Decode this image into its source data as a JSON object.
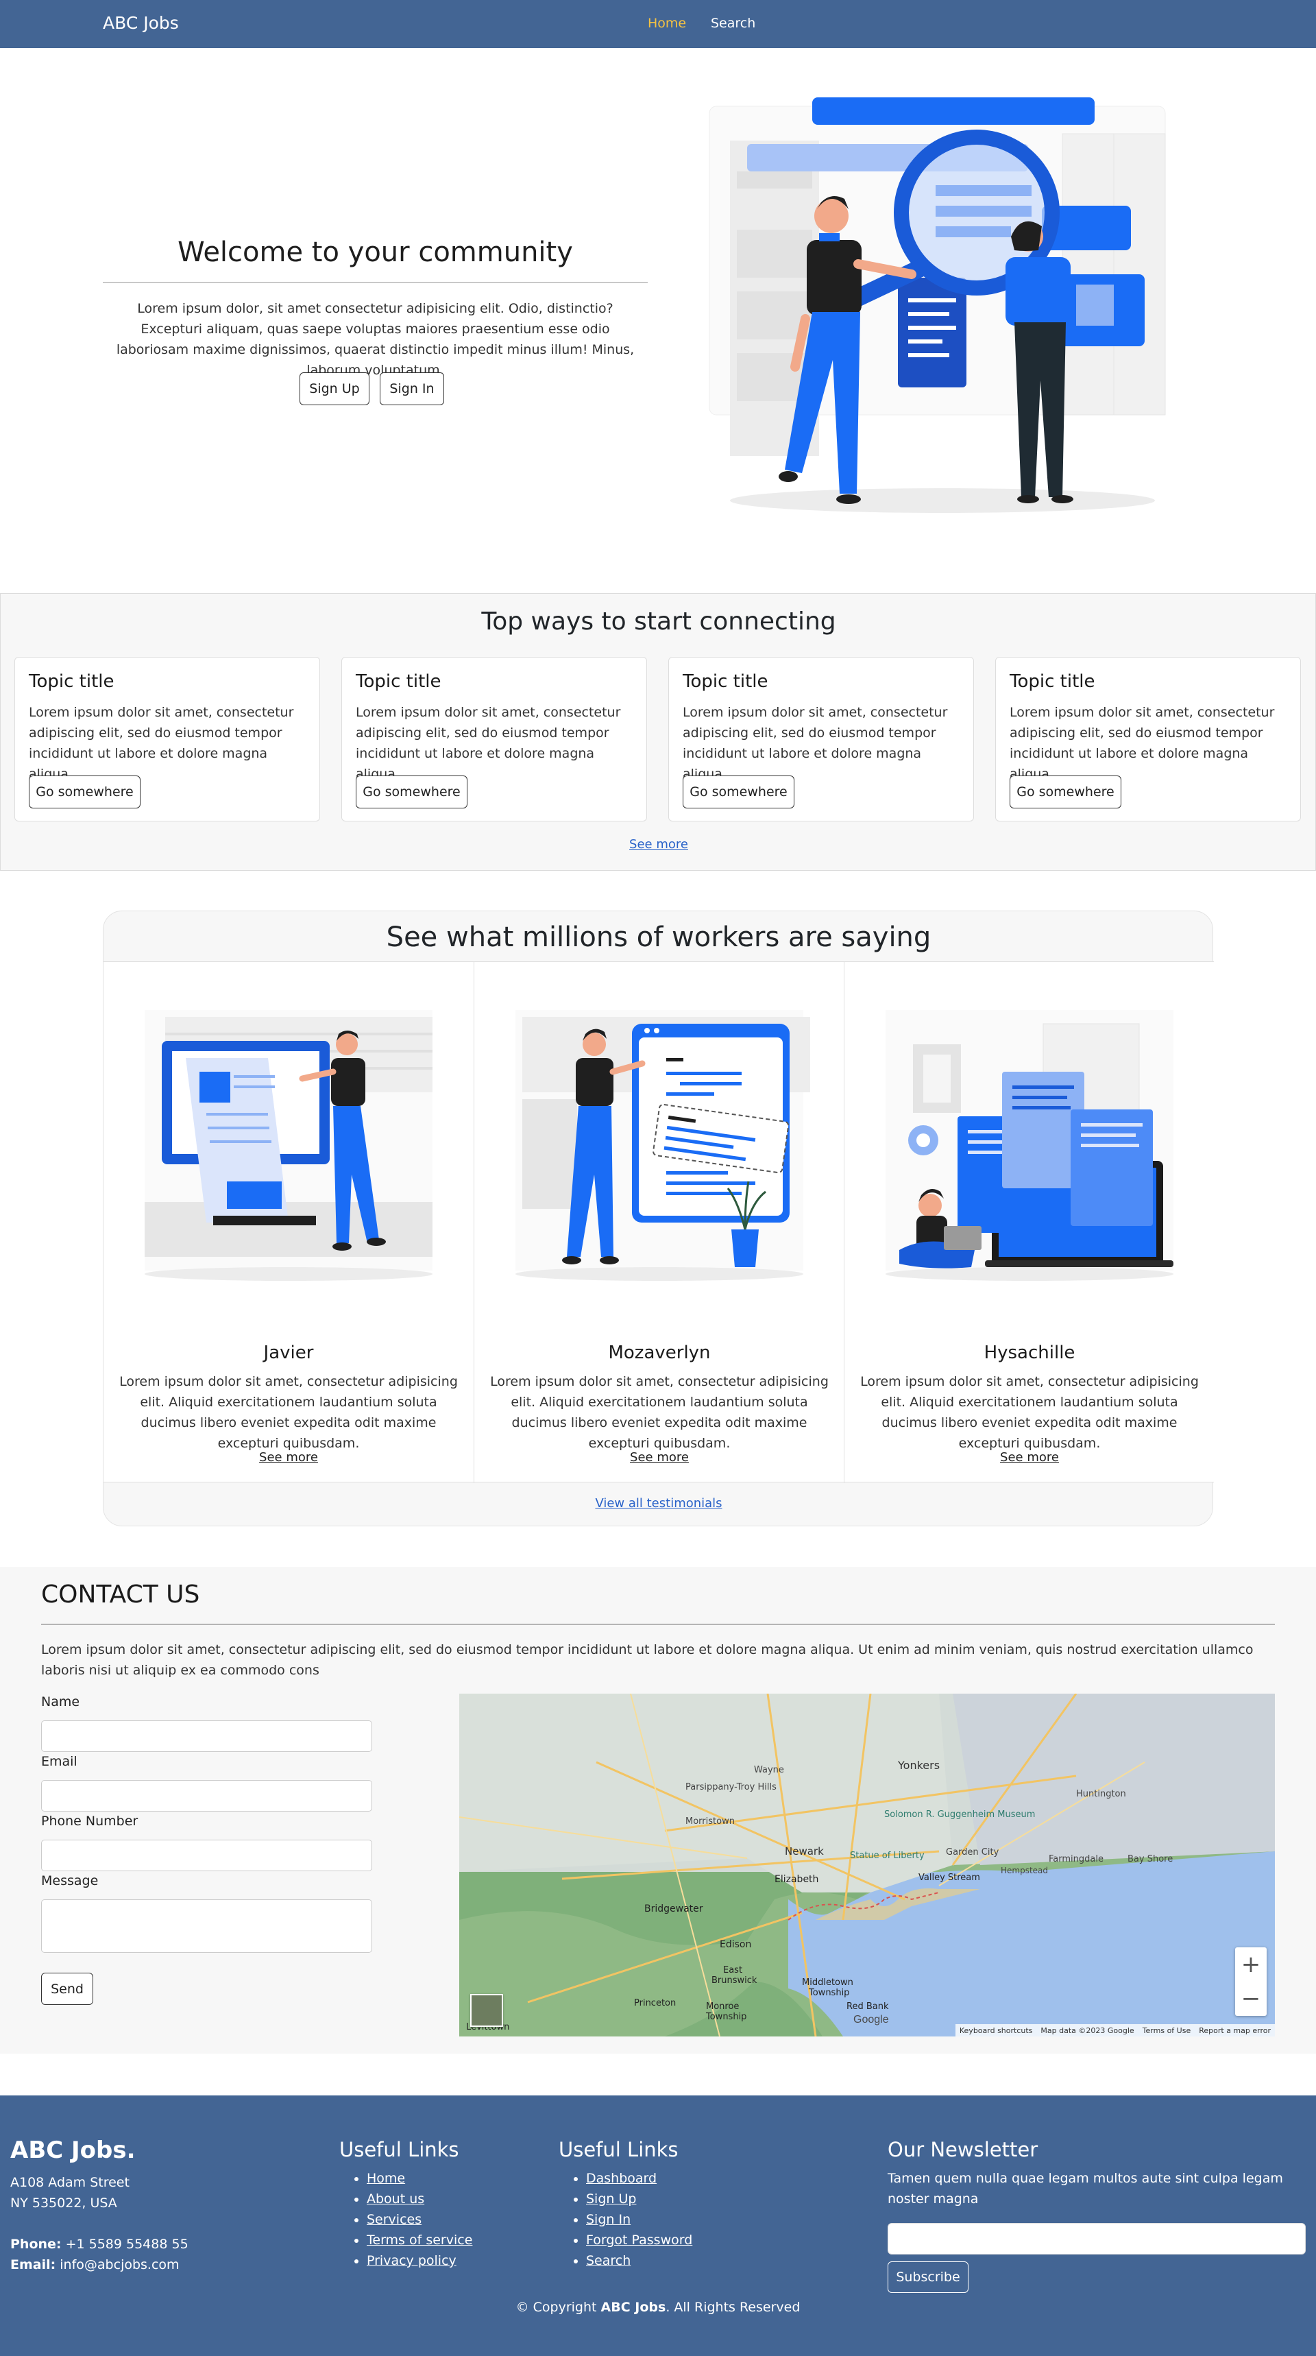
{
  "nav": {
    "brand": "ABC Jobs",
    "home": "Home",
    "search": "Search"
  },
  "hero": {
    "title": "Welcome to your community",
    "text": "Lorem ipsum dolor, sit amet consectetur adipisicing elit. Odio, distinctio? Excepturi aliquam, quas saepe voluptas maiores praesentium esse odio laboriosam maxime dignissimos, quaerat distinctio impedit minus illum! Minus, laborum voluptatum.",
    "signup": "Sign Up",
    "signin": "Sign In"
  },
  "ways": {
    "title": "Top ways to start connecting",
    "cards": [
      {
        "title": "Topic title",
        "text": "Lorem ipsum dolor sit amet, consectetur adipiscing elit, sed do eiusmod tempor incididunt ut labore et dolore magna aliqua.",
        "button": "Go somewhere"
      },
      {
        "title": "Topic title",
        "text": "Lorem ipsum dolor sit amet, consectetur adipiscing elit, sed do eiusmod tempor incididunt ut labore et dolore magna aliqua.",
        "button": "Go somewhere"
      },
      {
        "title": "Topic title",
        "text": "Lorem ipsum dolor sit amet, consectetur adipiscing elit, sed do eiusmod tempor incididunt ut labore et dolore magna aliqua.",
        "button": "Go somewhere"
      },
      {
        "title": "Topic title",
        "text": "Lorem ipsum dolor sit amet, consectetur adipiscing elit, sed do eiusmod tempor incididunt ut labore et dolore magna aliqua.",
        "button": "Go somewhere"
      }
    ],
    "see_more": "See more"
  },
  "testimonials": {
    "title": "See what millions of workers are saying",
    "items": [
      {
        "name": "Javier",
        "text": "Lorem ipsum dolor sit amet, consectetur adipisicing elit. Aliquid exercitationem laudantium soluta ducimus libero eveniet expedita odit maxime excepturi quibusdam.",
        "more": "See more"
      },
      {
        "name": "Mozaverlyn",
        "text": "Lorem ipsum dolor sit amet, consectetur adipisicing elit. Aliquid exercitationem laudantium soluta ducimus libero eveniet expedita odit maxime excepturi quibusdam.",
        "more": "See more"
      },
      {
        "name": "Hysachille",
        "text": "Lorem ipsum dolor sit amet, consectetur adipisicing elit. Aliquid exercitationem laudantium soluta ducimus libero eveniet expedita odit maxime excepturi quibusdam.",
        "more": "See more"
      }
    ],
    "view_all": "View all testimonials"
  },
  "contact": {
    "title": "CONTACT US",
    "text": "Lorem ipsum dolor sit amet, consectetur adipiscing elit, sed do eiusmod tempor incididunt ut labore et dolore magna aliqua. Ut enim ad minim veniam, quis nostrud exercitation ullamco laboris nisi ut aliquip ex ea commodo cons",
    "fields": {
      "name": "Name",
      "email": "Email",
      "phone": "Phone Number",
      "message": "Message"
    },
    "send": "Send",
    "map": {
      "labels": [
        "Yonkers",
        "Newark",
        "Elizabeth",
        "Bridgewater",
        "Edison",
        "East Brunswick",
        "Middletown Township",
        "Princeton",
        "Monroe Township",
        "Red Bank",
        "Valley Stream",
        "Garden City",
        "Farmingdale",
        "Bay Shore",
        "Huntington",
        "Parsippany-Troy Hills",
        "Wayne",
        "Morristown",
        "Solomon R. Guggenheim Museum",
        "Statue of Liberty",
        "Hempstead",
        "Levittown"
      ],
      "zoom_in": "+",
      "zoom_out": "−",
      "footer": [
        "Keyboard shortcuts",
        "Map data ©2023 Google",
        "Terms of Use",
        "Report a map error"
      ],
      "logo": "Google"
    }
  },
  "footer": {
    "brand": "ABC Jobs.",
    "address1": "A108 Adam Street",
    "address2": "NY 535022, USA",
    "phone_label": "Phone:",
    "phone": "+1 5589 55488 55",
    "email_label": "Email:",
    "email": "info@abcjobs.com",
    "links1_title": "Useful Links",
    "links1": [
      "Home",
      "About us",
      "Services",
      "Terms of service",
      "Privacy policy"
    ],
    "links2_title": "Useful Links",
    "links2": [
      "Dashboard",
      "Sign Up",
      "Sign In",
      "Forgot Password",
      "Search"
    ],
    "news_title": "Our Newsletter",
    "news_text": "Tamen quem nulla quae legam multos aute sint culpa legam noster magna",
    "subscribe": "Subscribe",
    "copy_pre": "© Copyright ",
    "copy_brand": "ABC Jobs",
    "copy_post": ". All Rights Reserved"
  },
  "colors": {
    "nav_bg": "#436594",
    "nav_active": "#f5c242",
    "accent_blue": "#1a6cf5",
    "link_blue": "#2a63c9"
  }
}
